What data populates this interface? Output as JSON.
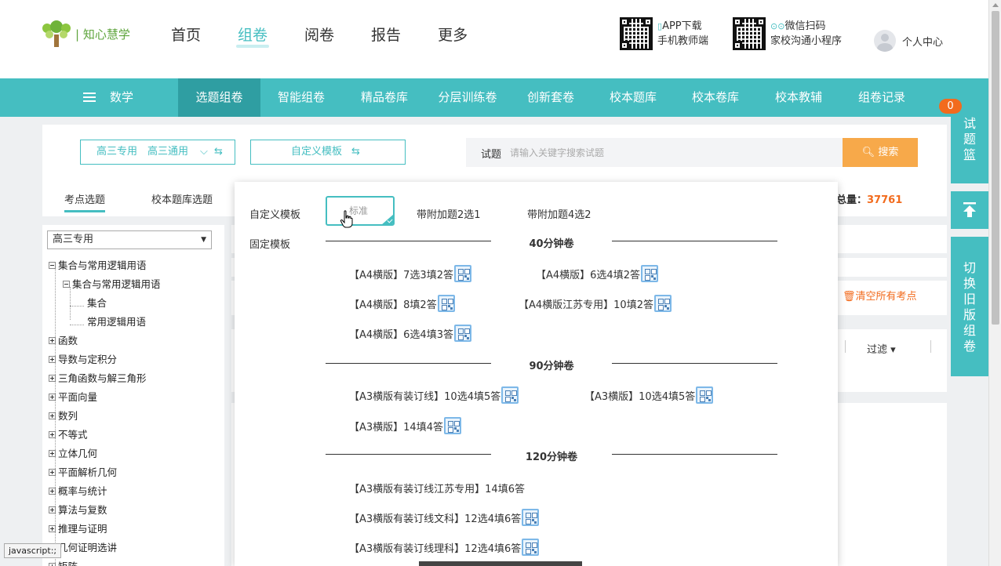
{
  "logo": {
    "text": "| 知心慧学"
  },
  "nav": {
    "items": [
      {
        "label": "首页",
        "active": false
      },
      {
        "label": "组卷",
        "active": true
      },
      {
        "label": "阅卷",
        "active": false
      },
      {
        "label": "报告",
        "active": false
      },
      {
        "label": "更多",
        "active": false
      }
    ]
  },
  "header": {
    "app_line1": "APP下载",
    "app_line2": "手机教师端",
    "wx_line1": "微信扫码",
    "wx_line2": "家校沟通小程序",
    "user": "个人中心"
  },
  "subnav": {
    "subject": "数学",
    "items": [
      "选题组卷",
      "智能组卷",
      "精品卷库",
      "分层训练卷",
      "创新套卷",
      "校本题库",
      "校本卷库",
      "校本教辅",
      "组卷记录"
    ],
    "active_index": 0
  },
  "rail": {
    "basket": "试题篮",
    "basket_count": "0",
    "switch": "切换旧版组卷",
    "top_arrow": "up-arrow"
  },
  "toolbar": {
    "grade_select": "高三专用　高三通用",
    "template_select": "自定义模板",
    "search_label": "试题",
    "search_placeholder": "请输入关键字搜索试题",
    "search_button": "搜索"
  },
  "tabs": [
    "考点选题",
    "校本题库选题"
  ],
  "total": {
    "label": "总量：",
    "value": "37761"
  },
  "tree": {
    "select": "高三专用",
    "nodes": [
      "集合与常用逻辑用语",
      "集合与常用逻辑用语",
      "集合",
      "常用逻辑用语",
      "函数",
      "导数与定积分",
      "三角函数与解三角形",
      "平面向量",
      "数列",
      "不等式",
      "立体几何",
      "平面解析几何",
      "概率与统计",
      "算法与复数",
      "推理与证明",
      "几何证明选讲",
      "矩阵"
    ]
  },
  "dropdown": {
    "custom_label": "自定义模板",
    "fixed_label": "固定模板",
    "custom_options": [
      "标准",
      "带附加题2选1",
      "带附加题4选2"
    ],
    "sections": [
      {
        "title": "40分钟卷",
        "items": [
          "【A4横版】7选3填2答",
          "【A4横版】6选4填2答",
          "【A4横版】8填2答",
          "【A4横版江苏专用】10填2答",
          "【A4横版】6选4填3答"
        ]
      },
      {
        "title": "90分钟卷",
        "items": [
          "【A3横版有装订线】10选4填5答",
          "【A3横版】10选4填5答",
          "【A3横版】14填4答"
        ]
      },
      {
        "title": "120分钟卷",
        "items": [
          "【A3横版有装订线江苏专用】14填6答",
          "【A3横版有装订线文科】12选4填6答",
          "【A3横版有装订线理科】12选4填6答"
        ]
      }
    ]
  },
  "right_area": {
    "clear_all": "清空所有考点",
    "filter": "过滤"
  },
  "status_bar": "javascript:;",
  "colors": {
    "teal": "#45bec1",
    "teal_dark": "#2f9ea2",
    "orange": "#f26b1d",
    "search_btn": "#f7a94a"
  }
}
